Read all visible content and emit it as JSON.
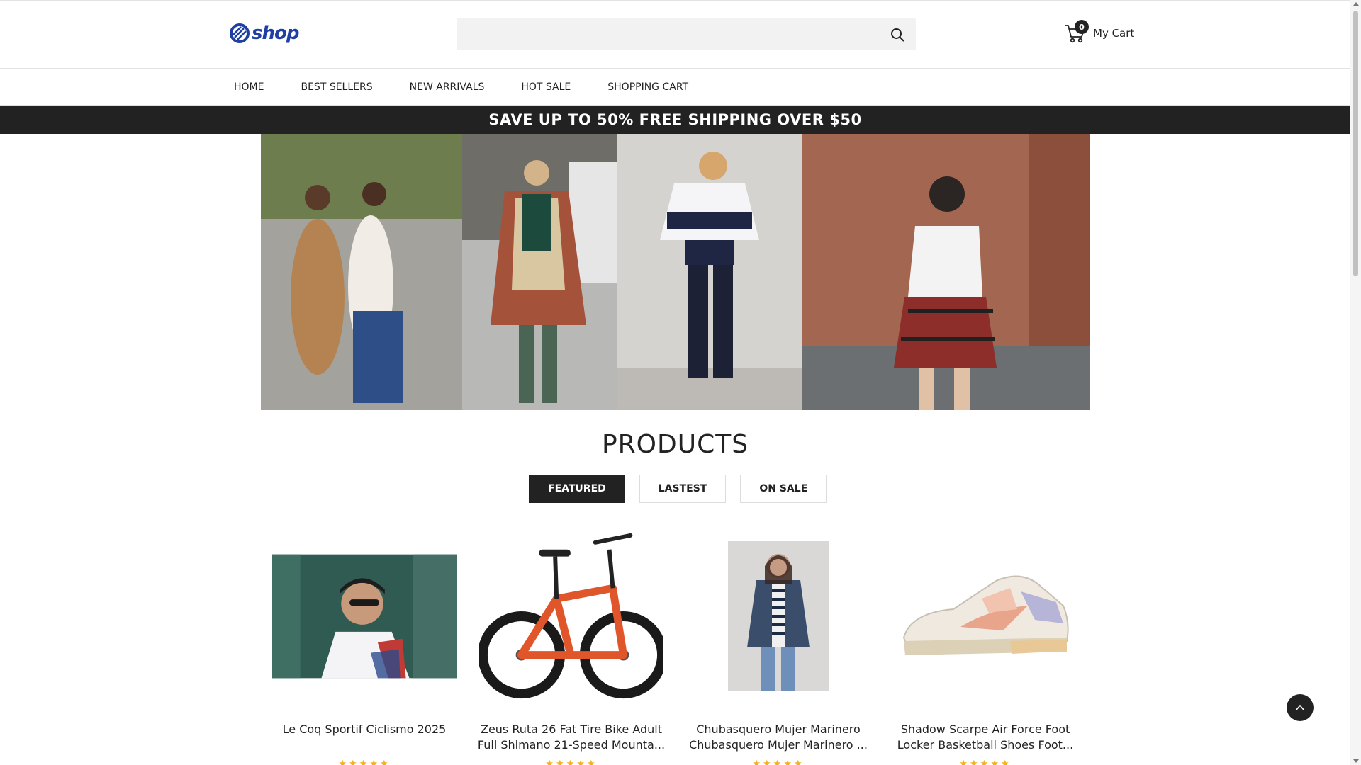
{
  "header": {
    "logo_text": "shop",
    "search": {
      "placeholder": "",
      "value": ""
    },
    "cart": {
      "count": "0",
      "label": "My Cart"
    }
  },
  "nav": {
    "items": [
      "HOME",
      "BEST SELLERS",
      "NEW ARRIVALS",
      "HOT SALE",
      "SHOPPING CART"
    ]
  },
  "promo": {
    "text": "SAVE UP TO 50% FREE SHIPPING OVER $50"
  },
  "products": {
    "title": "PRODUCTS",
    "tabs": [
      {
        "label": "FEATURED",
        "active": true
      },
      {
        "label": "LASTEST",
        "active": false
      },
      {
        "label": "ON SALE",
        "active": false
      }
    ],
    "items": [
      {
        "name_line1": "Le Coq Sportif Ciclismo 2025",
        "name_line2": "",
        "rating": "★★★★★"
      },
      {
        "name_line1": "Zeus Ruta 26 Fat Tire Bike Adult",
        "name_line2": "Full Shimano 21-Speed Mounta...",
        "rating": "★★★★★"
      },
      {
        "name_line1": "Chubasquero Mujer Marinero",
        "name_line2": "Chubasquero Mujer Marinero ...",
        "rating": "★★★★★"
      },
      {
        "name_line1": "Shadow Scarpe Air Force Foot",
        "name_line2": "Locker Basketball Shoes Foot...",
        "rating": "★★★★★"
      }
    ]
  },
  "colors": {
    "brand": "#1e3fa3",
    "dark": "#222222",
    "star": "#f3b41b"
  },
  "icons": [
    "logo-mark-icon",
    "search-icon",
    "cart-icon",
    "back-to-top-icon"
  ]
}
